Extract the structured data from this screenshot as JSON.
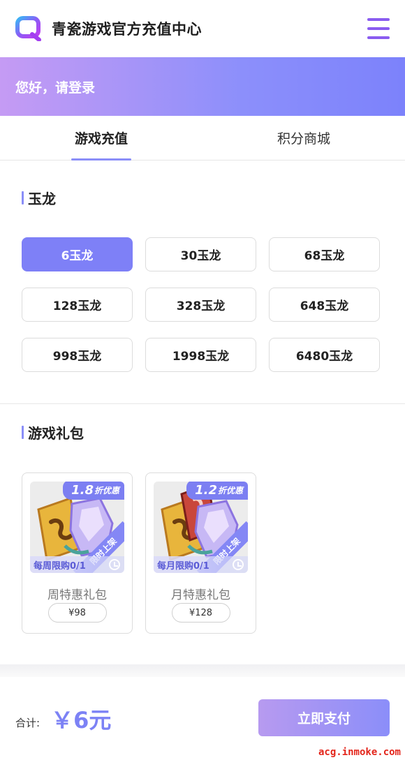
{
  "header": {
    "title": "青瓷游戏官方充值中心",
    "logo_icon": "q-logo-icon",
    "menu_icon": "hamburger-menu-icon"
  },
  "login": {
    "text": "您好，请登录"
  },
  "tabs": [
    {
      "label": "游戏充值",
      "active": true
    },
    {
      "label": "积分商城",
      "active": false
    }
  ],
  "currency": {
    "title": "玉龙",
    "options": [
      {
        "label": "6玉龙",
        "selected": true
      },
      {
        "label": "30玉龙",
        "selected": false
      },
      {
        "label": "68玉龙",
        "selected": false
      },
      {
        "label": "128玉龙",
        "selected": false
      },
      {
        "label": "328玉龙",
        "selected": false
      },
      {
        "label": "648玉龙",
        "selected": false
      },
      {
        "label": "998玉龙",
        "selected": false
      },
      {
        "label": "1998玉龙",
        "selected": false
      },
      {
        "label": "6480玉龙",
        "selected": false
      }
    ]
  },
  "gifts": {
    "title": "游戏礼包",
    "items": [
      {
        "discount_num": "1.8",
        "discount_text": "折优惠",
        "limit": "每周限购0/1",
        "ribbon": "限时上架",
        "name": "周特惠礼包",
        "price": "¥98"
      },
      {
        "discount_num": "1.2",
        "discount_text": "折优惠",
        "limit": "每月限购0/1",
        "ribbon": "限时上架",
        "name": "月特惠礼包",
        "price": "¥128"
      }
    ]
  },
  "footer": {
    "total_label": "合计:",
    "total_value": "￥6元",
    "pay_label": "立即支付"
  },
  "watermark": "acg.inmoke.com",
  "colors": {
    "accent": "#7e80f7",
    "brand_purple": "#8a5cf0"
  }
}
